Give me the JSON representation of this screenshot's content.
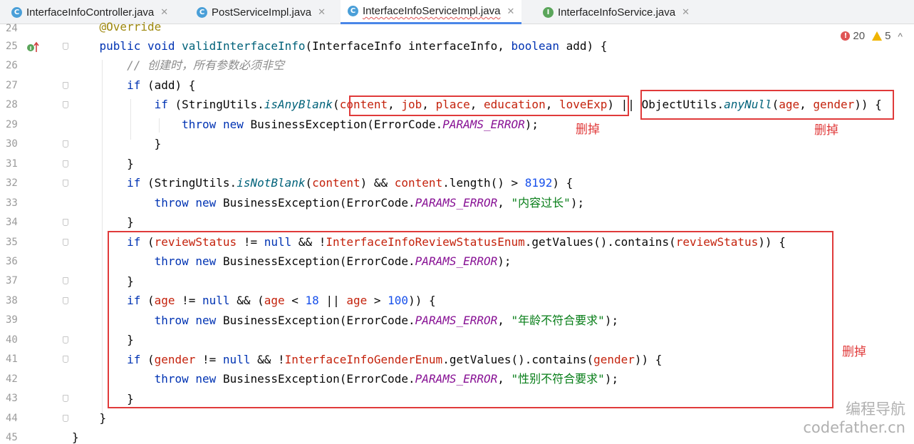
{
  "tabs": [
    {
      "label": "InterfaceInfoController.java",
      "icon": "class-icon",
      "icon_letter": "C",
      "active": false
    },
    {
      "label": "PostServiceImpl.java",
      "icon": "class-icon",
      "icon_letter": "C",
      "active": false
    },
    {
      "label": "InterfaceInfoServiceImpl.java",
      "icon": "class-icon",
      "icon_letter": "C",
      "active": true
    },
    {
      "label": "InterfaceInfoService.java",
      "icon": "interface-icon",
      "icon_letter": "I",
      "active": false
    }
  ],
  "close_glyph": "✕",
  "inspection": {
    "errors": "20",
    "warnings": "5",
    "expand_glyph": "^"
  },
  "line_numbers": [
    "24",
    "25",
    "26",
    "27",
    "28",
    "29",
    "30",
    "31",
    "32",
    "33",
    "34",
    "35",
    "36",
    "37",
    "38",
    "39",
    "40",
    "41",
    "42",
    "43",
    "44",
    "45"
  ],
  "code": {
    "l24": {
      "text": "@Override"
    },
    "l25": {
      "kw1": "public",
      "kw2": "void",
      "fn": "validInterfaceInfo",
      "p1": "(InterfaceInfo interfaceInfo, ",
      "kw3": "boolean",
      "p2": " add) {"
    },
    "l26": {
      "text": "// 创建时，所有参数必须非空"
    },
    "l27": {
      "kw": "if",
      "rest": " (add) {"
    },
    "l28": {
      "kw": "if",
      "a": " (StringUtils.",
      "fn": "isAnyBlank",
      "b": "(",
      "v1": "content",
      "c1": ", ",
      "v2": "job",
      "c2": ", ",
      "v3": "place",
      "c3": ", ",
      "v4": "education",
      "c4": ", ",
      "v5": "loveExp",
      "d": ") || ObjectUtils.",
      "fn2": "anyNull",
      "e": "(",
      "v6": "age",
      "c5": ", ",
      "v7": "gender",
      "f": ")) {"
    },
    "l29": {
      "kw1": "throw",
      "kw2": "new",
      "a": " BusinessException(ErrorCode.",
      "cst": "PARAMS_ERROR",
      "b": ");"
    },
    "l30": {
      "text": "}"
    },
    "l31": {
      "text": "}"
    },
    "l32": {
      "kw": "if",
      "a": " (StringUtils.",
      "fn": "isNotBlank",
      "b": "(",
      "v1": "content",
      "c": ") && ",
      "v2": "content",
      "d": ".length() > ",
      "num": "8192",
      "e": ") {"
    },
    "l33": {
      "kw1": "throw",
      "kw2": "new",
      "a": " BusinessException(ErrorCode.",
      "cst": "PARAMS_ERROR",
      "b": ", ",
      "str": "\"内容过长\"",
      "c": ");"
    },
    "l34": {
      "text": "}"
    },
    "l35": {
      "kw": "if",
      "a": " (",
      "v1": "reviewStatus",
      "b": " != ",
      "kw2": "null",
      "c": " && !",
      "v2": "InterfaceInfoReviewStatusEnum",
      "d": ".getValues().contains(",
      "v3": "reviewStatus",
      "e": ")) {"
    },
    "l36": {
      "kw1": "throw",
      "kw2": "new",
      "a": " BusinessException(ErrorCode.",
      "cst": "PARAMS_ERROR",
      "b": ");"
    },
    "l37": {
      "text": "}"
    },
    "l38": {
      "kw": "if",
      "a": " (",
      "v1": "age",
      "b": " != ",
      "kw2": "null",
      "c": " && (",
      "v2": "age",
      "d": " < ",
      "n1": "18",
      "e": " || ",
      "v3": "age",
      "f": " > ",
      "n2": "100",
      "g": ")) {"
    },
    "l39": {
      "kw1": "throw",
      "kw2": "new",
      "a": " BusinessException(ErrorCode.",
      "cst": "PARAMS_ERROR",
      "b": ", ",
      "str": "\"年龄不符合要求\"",
      "c": ");"
    },
    "l40": {
      "text": "}"
    },
    "l41": {
      "kw": "if",
      "a": " (",
      "v1": "gender",
      "b": " != ",
      "kw2": "null",
      "c": " && !",
      "v2": "InterfaceInfoGenderEnum",
      "d": ".getValues().contains(",
      "v3": "gender",
      "e": ")) {"
    },
    "l42": {
      "kw1": "throw",
      "kw2": "new",
      "a": " BusinessException(ErrorCode.",
      "cst": "PARAMS_ERROR",
      "b": ", ",
      "str": "\"性别不符合要求\"",
      "c": ");"
    },
    "l43": {
      "text": "}"
    },
    "l44": {
      "text": "}"
    },
    "l45": {
      "text": "}"
    }
  },
  "annotations": {
    "delete_1": "删掉",
    "delete_2": "删掉",
    "delete_3": "删掉"
  },
  "watermark": {
    "line1": "编程导航",
    "line2": "codefather.cn"
  },
  "colors": {
    "annotation_red": "#e03a3a",
    "keyword": "#0033b3",
    "field": "#c4220c",
    "string": "#067d17",
    "number": "#1750eb",
    "constant": "#871094",
    "active_tab_underline": "#4a86e8"
  }
}
